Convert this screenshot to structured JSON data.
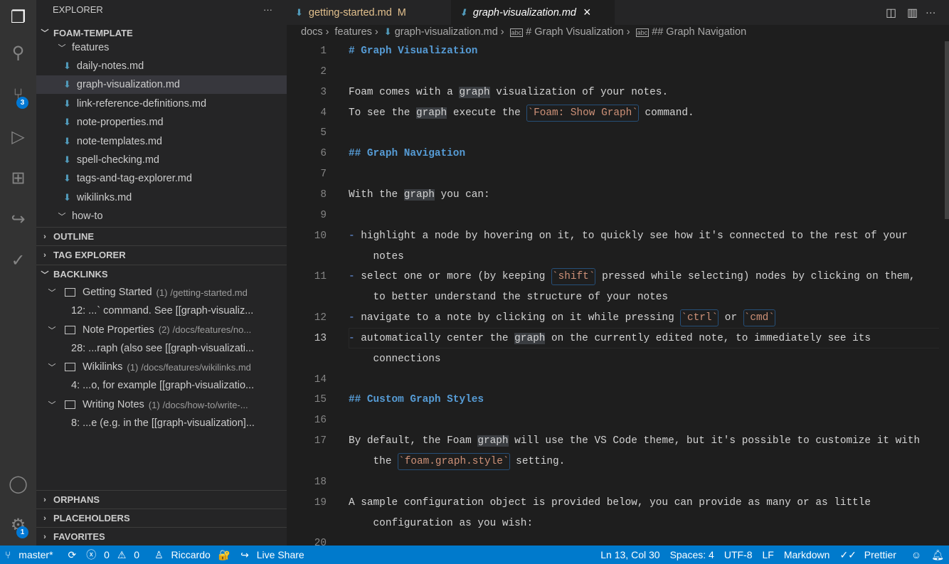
{
  "activity": {
    "scm_badge": "3",
    "settings_badge": "1"
  },
  "sidebar": {
    "title": "EXPLORER",
    "more": "···",
    "workspace": "FOAM-TEMPLATE",
    "folder_features": "features",
    "folder_howto": "how-to",
    "files": [
      "daily-notes.md",
      "graph-visualization.md",
      "link-reference-definitions.md",
      "note-properties.md",
      "note-templates.md",
      "spell-checking.md",
      "tags-and-tag-explorer.md",
      "wikilinks.md"
    ],
    "selected_file": "graph-visualization.md",
    "sections": {
      "outline": "OUTLINE",
      "tag_explorer": "TAG EXPLORER",
      "backlinks": "BACKLINKS",
      "orphans": "ORPHANS",
      "placeholders": "PLACEHOLDERS",
      "favorites": "FAVORITES"
    },
    "backlinks": [
      {
        "title": "Getting Started",
        "count": "(1)",
        "path": "/getting-started.md",
        "snippet": "12: ...` command. See [[graph-visualiz..."
      },
      {
        "title": "Note Properties",
        "count": "(2)",
        "path": "/docs/features/no...",
        "snippet": "28: ...raph (also see [[graph-visualizati..."
      },
      {
        "title": "Wikilinks",
        "count": "(1)",
        "path": "/docs/features/wikilinks.md",
        "snippet": "4: ...o, for example [[graph-visualizatio..."
      },
      {
        "title": "Writing Notes",
        "count": "(1)",
        "path": "/docs/how-to/write-...",
        "snippet": "8: ...e (e.g. in the [[graph-visualization]..."
      }
    ]
  },
  "tabs": [
    {
      "label": "getting-started.md",
      "status": "M"
    },
    {
      "label": "graph-visualization.md",
      "close": "×"
    }
  ],
  "breadcrumb": [
    "docs",
    "features",
    "graph-visualization.md",
    "# Graph Visualization",
    "## Graph Navigation"
  ],
  "editor": {
    "current_line": 13,
    "rows": [
      {
        "n": "1",
        "s": [
          [
            "# Graph Visualization",
            "h"
          ]
        ]
      },
      {
        "n": "2",
        "s": []
      },
      {
        "n": "3",
        "s": [
          [
            "Foam comes with a ",
            ""
          ],
          [
            "graph",
            "g"
          ],
          [
            " visualization of your notes.",
            ""
          ]
        ]
      },
      {
        "n": "4",
        "s": [
          [
            "To see the ",
            ""
          ],
          [
            "graph",
            "g"
          ],
          [
            " execute the ",
            ""
          ],
          [
            "`Foam: Show Graph`",
            "c"
          ],
          [
            " command.",
            ""
          ]
        ]
      },
      {
        "n": "5",
        "s": []
      },
      {
        "n": "6",
        "s": [
          [
            "## Graph Navigation",
            "h"
          ]
        ]
      },
      {
        "n": "7",
        "s": []
      },
      {
        "n": "8",
        "s": [
          [
            "With the ",
            ""
          ],
          [
            "graph",
            "g"
          ],
          [
            " you can:",
            ""
          ]
        ]
      },
      {
        "n": "9",
        "s": []
      },
      {
        "n": "10",
        "s": [
          [
            "-",
            "d"
          ],
          [
            " highlight a node by hovering on it, to quickly see how it's connected to the rest of your",
            ""
          ]
        ]
      },
      {
        "n": "",
        "s": [
          [
            "    notes",
            ""
          ]
        ]
      },
      {
        "n": "11",
        "s": [
          [
            "-",
            "d"
          ],
          [
            " select one or more (by keeping ",
            ""
          ],
          [
            "`shift`",
            "c"
          ],
          [
            " pressed while selecting) nodes by clicking on them,",
            ""
          ]
        ]
      },
      {
        "n": "",
        "s": [
          [
            "    to better understand the structure of your notes",
            ""
          ]
        ]
      },
      {
        "n": "12",
        "s": [
          [
            "-",
            "d"
          ],
          [
            " navigate to a note by clicking on it while pressing ",
            ""
          ],
          [
            "`ctrl`",
            "c"
          ],
          [
            " or ",
            ""
          ],
          [
            "`cmd`",
            "c"
          ]
        ]
      },
      {
        "n": "13",
        "s": [
          [
            "-",
            "d"
          ],
          [
            " automatically center the ",
            ""
          ],
          [
            "graph",
            "g"
          ],
          [
            " on the currently edited note, to immediately see its",
            ""
          ]
        ]
      },
      {
        "n": "",
        "s": [
          [
            "    connections",
            ""
          ]
        ]
      },
      {
        "n": "14",
        "s": []
      },
      {
        "n": "15",
        "s": [
          [
            "## Custom Graph Styles",
            "h"
          ]
        ]
      },
      {
        "n": "16",
        "s": []
      },
      {
        "n": "17",
        "s": [
          [
            "By default, the Foam ",
            ""
          ],
          [
            "graph",
            "g"
          ],
          [
            " will use the VS Code theme, but it's possible to customize it with",
            ""
          ]
        ]
      },
      {
        "n": "",
        "s": [
          [
            "    the ",
            ""
          ],
          [
            "`foam.graph.style`",
            "c"
          ],
          [
            " setting.",
            ""
          ]
        ]
      },
      {
        "n": "18",
        "s": []
      },
      {
        "n": "19",
        "s": [
          [
            "A sample configuration object is provided below, you can provide as many or as little",
            ""
          ]
        ]
      },
      {
        "n": "",
        "s": [
          [
            "    configuration as you wish:",
            ""
          ]
        ]
      },
      {
        "n": "20",
        "s": []
      }
    ]
  },
  "statusbar": {
    "branch": "master*",
    "errors": "0",
    "warnings": "0",
    "user": "Riccardo",
    "liveshare": "Live Share",
    "position": "Ln 13, Col 30",
    "spaces": "Spaces: 4",
    "encoding": "UTF-8",
    "eol": "LF",
    "language": "Markdown",
    "prettier": "Prettier"
  }
}
